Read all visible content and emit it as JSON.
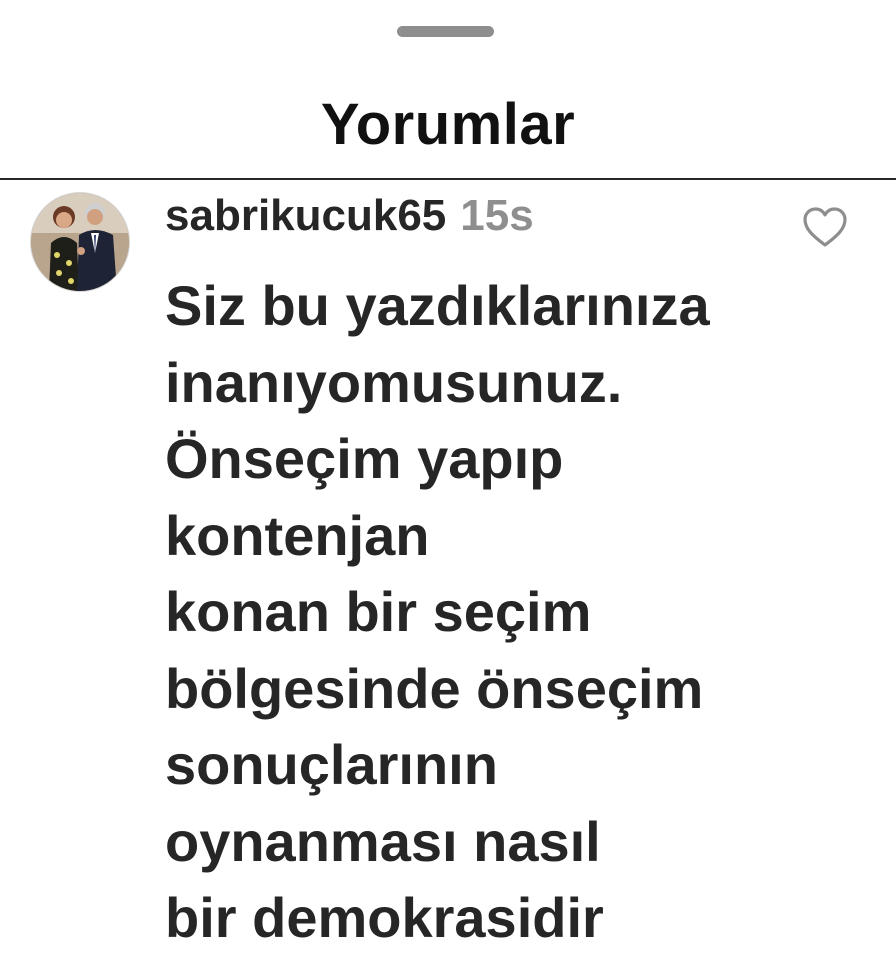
{
  "sheet": {
    "title": "Yorumlar"
  },
  "comment": {
    "username": "sabrikucuk65",
    "time": "15s",
    "text_lines": [
      "Siz bu yazdıklarınıza",
      "inanıyomusunuz.",
      "Önseçim yapıp",
      "kontenjan",
      "konan bir seçim",
      "bölgesinde önseçim",
      "sonuçlarının",
      "oynanması nasıl",
      "bir demokrasidir"
    ],
    "like_icon": "heart-outline-icon"
  },
  "colors": {
    "text_primary": "#262626",
    "text_secondary": "#8e8e8e",
    "handle": "#8e8e8e",
    "background": "#ffffff"
  }
}
